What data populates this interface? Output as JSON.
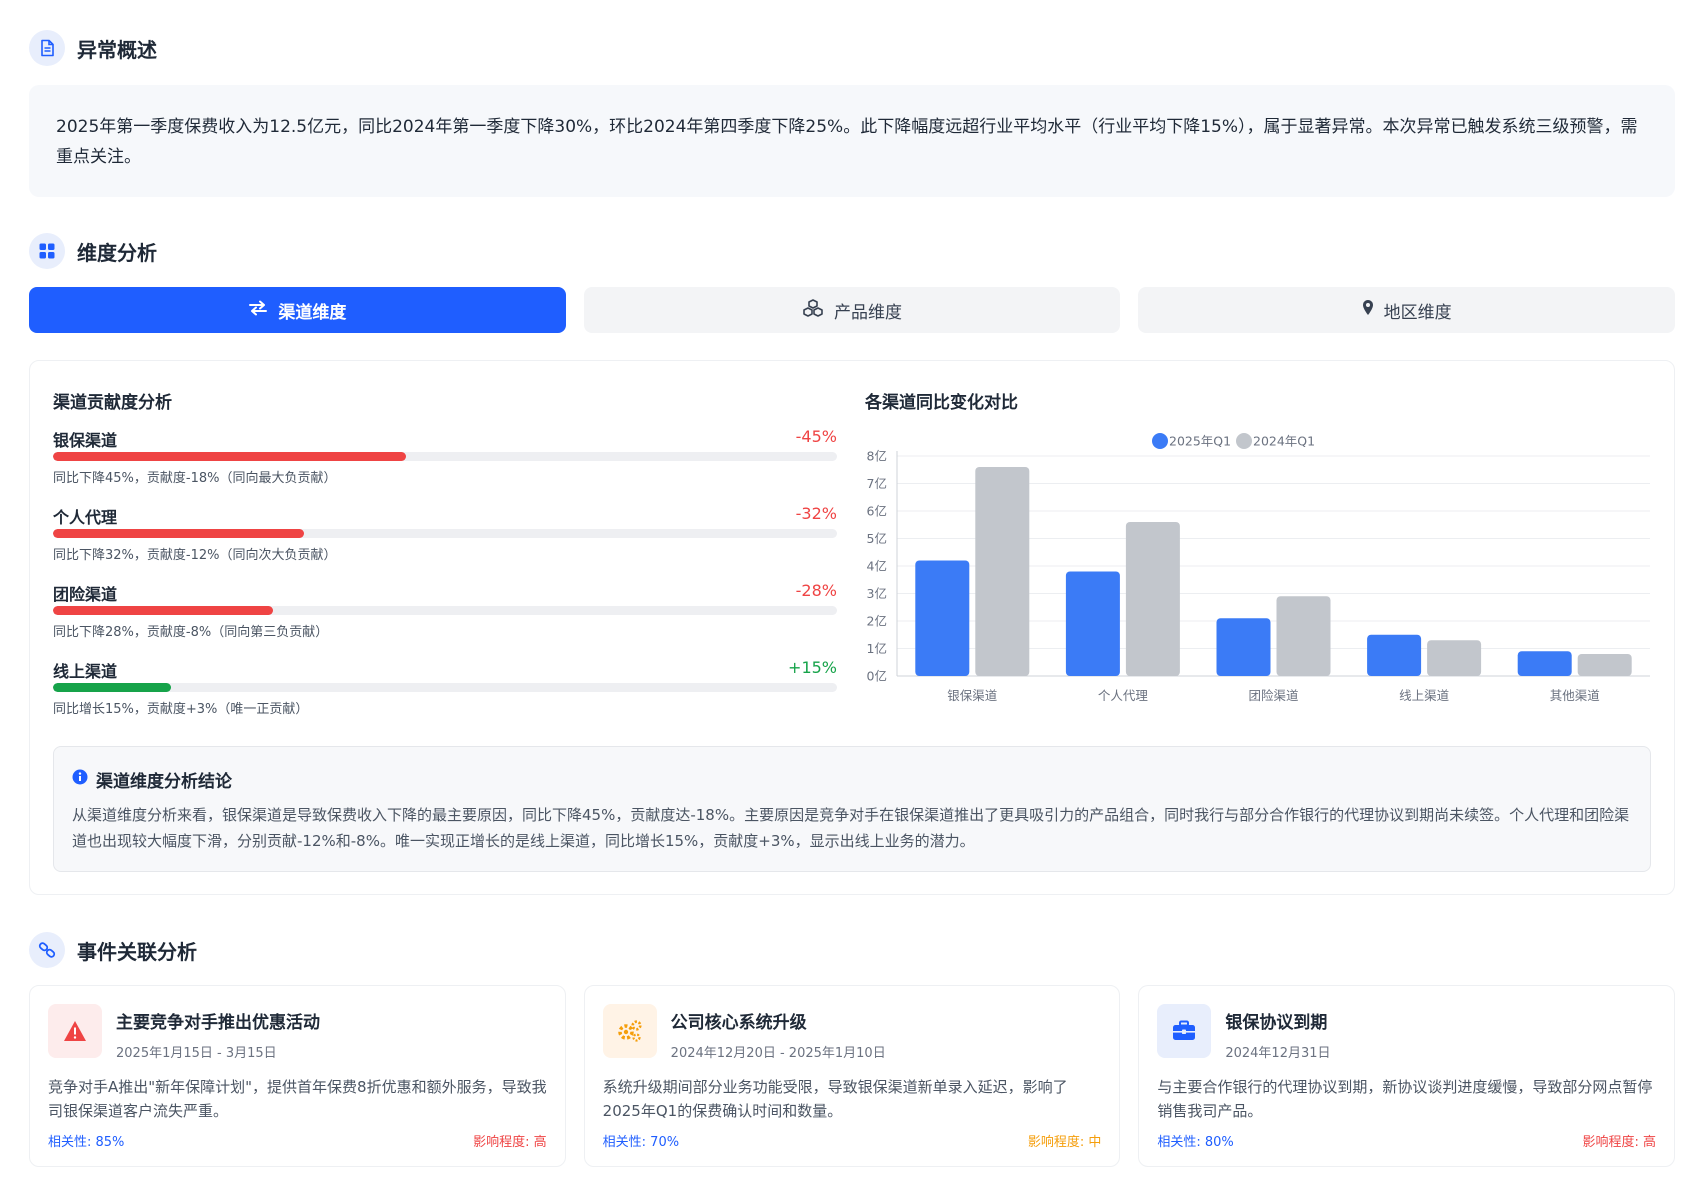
{
  "overview": {
    "title": "异常概述",
    "text": "2025年第一季度保费收入为12.5亿元，同比2024年第一季度下降30%，环比2024年第四季度下降25%。此下降幅度远超行业平均水平（行业平均下降15%），属于显著异常。本次异常已触发系统三级预警，需重点关注。"
  },
  "dimension": {
    "title": "维度分析",
    "tabs": [
      {
        "label": "渠道维度",
        "icon": "exchange-icon",
        "active": true
      },
      {
        "label": "产品维度",
        "icon": "cubes-icon",
        "active": false
      },
      {
        "label": "地区维度",
        "icon": "map-pin-icon",
        "active": false
      }
    ],
    "contribution_title": "渠道贡献度分析",
    "contributions": [
      {
        "name": "银保渠道",
        "value": "-45%",
        "desc": "同比下降45%，贡献度-18%（同向最大负贡献）",
        "fill": 0.45,
        "color": "#ef4444"
      },
      {
        "name": "个人代理",
        "value": "-32%",
        "desc": "同比下降32%，贡献度-12%（同向次大负贡献）",
        "fill": 0.32,
        "color": "#ef4444"
      },
      {
        "name": "团险渠道",
        "value": "-28%",
        "desc": "同比下降28%，贡献度-8%（同向第三负贡献）",
        "fill": 0.28,
        "color": "#ef4444"
      },
      {
        "name": "线上渠道",
        "value": "+15%",
        "desc": "同比增长15%，贡献度+3%（唯一正贡献）",
        "fill": 0.15,
        "color": "#16a34a"
      }
    ],
    "chart_title": "各渠道同比变化对比",
    "conclusion_title": "渠道维度分析结论",
    "conclusion_text": "从渠道维度分析来看，银保渠道是导致保费收入下降的最主要原因，同比下降45%，贡献度达-18%。主要原因是竞争对手在银保渠道推出了更具吸引力的产品组合，同时我行与部分合作银行的代理协议到期尚未续签。个人代理和团险渠道也出现较大幅度下滑，分别贡献-12%和-8%。唯一实现正增长的是线上渠道，同比增长15%，贡献度+3%，显示出线上业务的潜力。"
  },
  "chart_data": {
    "type": "bar",
    "categories": [
      "银保渠道",
      "个人代理",
      "团险渠道",
      "线上渠道",
      "其他渠道"
    ],
    "series": [
      {
        "name": "2025年Q1",
        "values": [
          4.2,
          3.8,
          2.1,
          1.5,
          0.9
        ],
        "color": "#3b7bf6"
      },
      {
        "name": "2024年Q1",
        "values": [
          7.6,
          5.6,
          2.9,
          1.3,
          0.8
        ],
        "color": "#c2c6cc"
      }
    ],
    "y_ticks": [
      "0亿",
      "1亿",
      "2亿",
      "3亿",
      "4亿",
      "5亿",
      "6亿",
      "7亿",
      "8亿"
    ],
    "ylim": [
      0,
      8
    ],
    "grid": true,
    "legend": "top-center"
  },
  "events": {
    "title": "事件关联分析",
    "items": [
      {
        "title": "主要竞争对手推出优惠活动",
        "date": "2025年1月15日 - 3月15日",
        "desc": "竞争对手A推出\"新年保障计划\"，提供首年保费8折优惠和额外服务，导致我司银保渠道客户流失严重。",
        "relevance": "相关性: 85%",
        "impact": "影响程度: 高",
        "impact_color": "#ef4444",
        "icon": "warning-icon",
        "icon_bg": "#fdecec",
        "icon_color": "#ef4444"
      },
      {
        "title": "公司核心系统升级",
        "date": "2024年12月20日 - 2025年1月10日",
        "desc": "系统升级期间部分业务功能受限，导致银保渠道新单录入延迟，影响了2025年Q1的保费确认时间和数量。",
        "relevance": "相关性: 70%",
        "impact": "影响程度: 中",
        "impact_color": "#f59e0b",
        "icon": "gears-icon",
        "icon_bg": "#fff3e6",
        "icon_color": "#f59e0b"
      },
      {
        "title": "银保协议到期",
        "date": "2024年12月31日",
        "desc": "与主要合作银行的代理协议到期，新协议谈判进度缓慢，导致部分网点暂停销售我司产品。",
        "relevance": "相关性: 80%",
        "impact": "影响程度: 高",
        "impact_color": "#ef4444",
        "icon": "briefcase-icon",
        "icon_bg": "#e8eefc",
        "icon_color": "#1f5eff"
      }
    ]
  }
}
